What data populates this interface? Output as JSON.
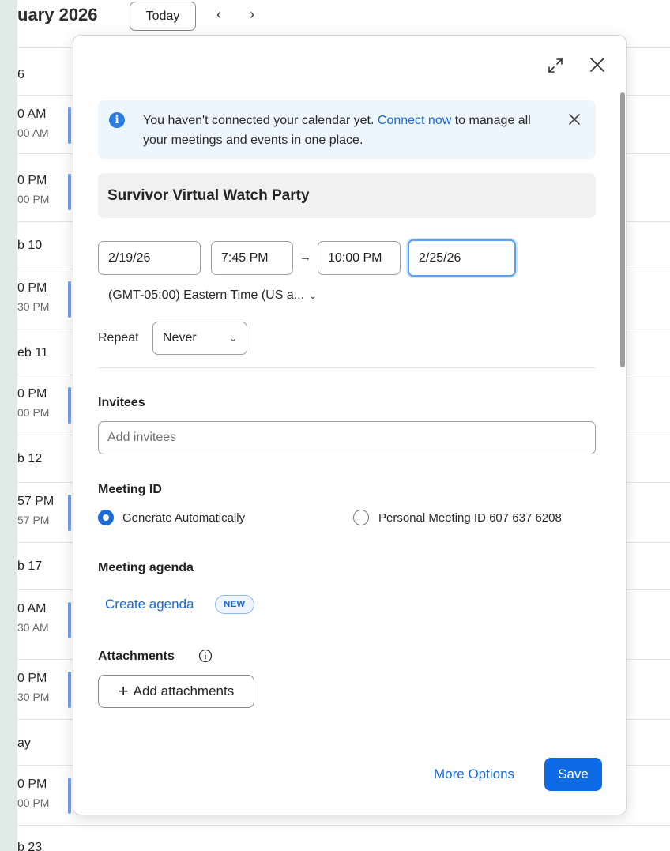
{
  "calendar": {
    "month_title": "uary 2026",
    "today_label": "Today",
    "prev_label": "‹",
    "next_label": "›",
    "days": [
      "6",
      "b 10",
      "eb 11",
      "b 12",
      "b 17",
      "ay",
      "b 23"
    ],
    "events": [
      {
        "t1": "0 AM",
        "t2": "00 AM"
      },
      {
        "t1": "0 PM",
        "t2": "00 PM"
      },
      {
        "t1": "0 PM",
        "t2": "30 PM"
      },
      {
        "t1": "0 PM",
        "t2": "00 PM"
      },
      {
        "t1": "57 PM",
        "t2": "57 PM"
      },
      {
        "t1": "0 AM",
        "t2": "30 AM"
      },
      {
        "t1": "0 PM",
        "t2": "30 PM"
      },
      {
        "t1": "0 PM",
        "t2": "00 PM"
      }
    ]
  },
  "modal": {
    "alert": {
      "text_before": "You haven't connected your calendar yet. ",
      "link": "Connect now",
      "text_after": " to manage all your meetings and events in one place.",
      "icon": "info-icon"
    },
    "title": "Survivor Virtual Watch Party",
    "start_date": "2/19/26",
    "start_time": "7:45 PM",
    "arrow": "→",
    "end_time": "10:00 PM",
    "end_date": "2/25/26",
    "timezone": "(GMT-05:00) Eastern Time (US a...",
    "repeat_label": "Repeat",
    "repeat_value": "Never",
    "invitees_label": "Invitees",
    "invitees_placeholder": "Add invitees",
    "meeting_id_label": "Meeting ID",
    "generate_auto": "Generate Automatically",
    "personal_id": "Personal Meeting ID 607 637 6208",
    "agenda_label": "Meeting agenda",
    "create_agenda": "Create agenda",
    "new_badge": "NEW",
    "attachments_label": "Attachments",
    "add_attachments": "Add attachments",
    "more_options": "More Options",
    "save": "Save"
  },
  "colors": {
    "accent": "#1a6ad8",
    "save_button": "#0e6ae4",
    "alert_bg": "#edf5fd",
    "event_bar": "#6ea2ee"
  }
}
